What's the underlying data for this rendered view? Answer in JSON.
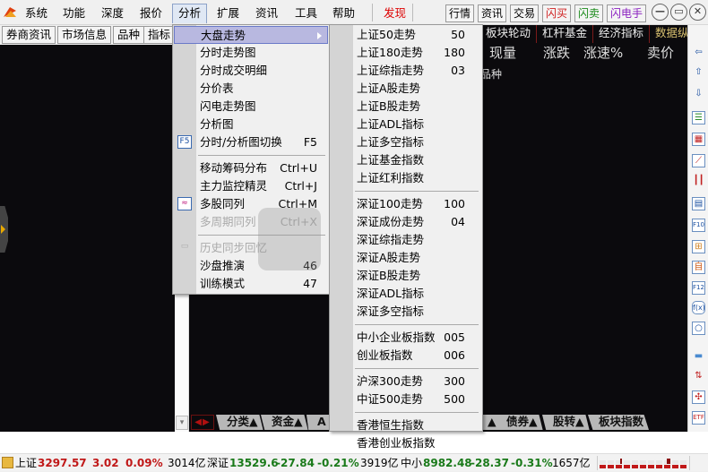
{
  "menubar": {
    "items": [
      "系统",
      "功能",
      "深度",
      "报价",
      "分析",
      "扩展",
      "资讯",
      "工具",
      "帮助",
      "发现"
    ],
    "active": "分析",
    "toolbar_buttons": [
      {
        "label": "行情",
        "color": "#000000"
      },
      {
        "label": "资讯",
        "color": "#000000"
      },
      {
        "label": "交易",
        "color": "#000000"
      },
      {
        "label": "闪买",
        "color": "#d02020"
      },
      {
        "label": "闪卖",
        "color": "#1a8a1a"
      },
      {
        "label": "闪电手",
        "color": "#8a20c0"
      }
    ],
    "window_controls": {
      "minimize": "—",
      "restore": "▭",
      "close": "✕"
    }
  },
  "subbar": {
    "buttons": [
      "券商资讯",
      "市场信息",
      "品种",
      "指标"
    ]
  },
  "header_tabs": [
    "板块轮动",
    "杠杆基金",
    "经济指标",
    "数据纵览"
  ],
  "column_headers": [
    "现量",
    "涨跌",
    "涨速%",
    "卖价"
  ],
  "row_label_fragment": "品种",
  "analysis_menu": {
    "items": [
      {
        "label": "大盘走势",
        "shortcut": "",
        "highlighted": true,
        "submenu": true
      },
      {
        "label": "分时走势图",
        "shortcut": ""
      },
      {
        "label": "分时成交明细",
        "shortcut": ""
      },
      {
        "label": "分价表",
        "shortcut": ""
      },
      {
        "label": "闪电走势图",
        "shortcut": ""
      },
      {
        "label": "分析图",
        "shortcut": ""
      },
      {
        "label": "分时/分析图切换",
        "shortcut": "F5",
        "icon": "F5"
      },
      {
        "separator": true
      },
      {
        "label": "移动筹码分布",
        "shortcut": "Ctrl+U"
      },
      {
        "label": "主力监控精灵",
        "shortcut": "Ctrl+J"
      },
      {
        "label": "多股同列",
        "shortcut": "Ctrl+M",
        "icon": "multi-chart"
      },
      {
        "label": "多周期同列",
        "shortcut": "Ctrl+X",
        "disabled": true
      },
      {
        "separator": true
      },
      {
        "label": "历史同步回忆",
        "shortcut": "",
        "disabled": true,
        "icon": "history"
      },
      {
        "label": "沙盘推演",
        "shortcut": "46"
      },
      {
        "label": "训练模式",
        "shortcut": "47"
      }
    ]
  },
  "market_submenu": {
    "groups": [
      [
        {
          "label": "上证50走势",
          "shortcut": "50"
        },
        {
          "label": "上证180走势",
          "shortcut": "180"
        },
        {
          "label": "上证综指走势",
          "shortcut": "03"
        },
        {
          "label": "上证A股走势",
          "shortcut": ""
        },
        {
          "label": "上证B股走势",
          "shortcut": ""
        },
        {
          "label": "上证ADL指标",
          "shortcut": ""
        },
        {
          "label": "上证多空指标",
          "shortcut": ""
        },
        {
          "label": "上证基金指数",
          "shortcut": ""
        },
        {
          "label": "上证红利指数",
          "shortcut": ""
        }
      ],
      [
        {
          "label": "深证100走势",
          "shortcut": "100"
        },
        {
          "label": "深证成份走势",
          "shortcut": "04"
        },
        {
          "label": "深证综指走势",
          "shortcut": ""
        },
        {
          "label": "深证A股走势",
          "shortcut": ""
        },
        {
          "label": "深证B股走势",
          "shortcut": ""
        },
        {
          "label": "深证ADL指标",
          "shortcut": ""
        },
        {
          "label": "深证多空指标",
          "shortcut": ""
        }
      ],
      [
        {
          "label": "中小企业板指数",
          "shortcut": "005"
        },
        {
          "label": "创业板指数",
          "shortcut": "006"
        }
      ],
      [
        {
          "label": "沪深300走势",
          "shortcut": "300"
        },
        {
          "label": "中证500走势",
          "shortcut": "500"
        }
      ],
      [
        {
          "label": "香港恒生指数",
          "shortcut": ""
        },
        {
          "label": "香港创业板指数",
          "shortcut": ""
        }
      ]
    ]
  },
  "bottom_tabs": [
    "分类▲",
    "资金▲",
    "A",
    "▲",
    "债券▲",
    "股转▲",
    "板块指数"
  ],
  "status": {
    "sh": {
      "name": "上证",
      "value": "3297.57",
      "change": "3.02",
      "pct": "0.09%",
      "volume": "3014亿"
    },
    "sz": {
      "name": "深证",
      "value": "13529.6",
      "change": "-27.84",
      "pct": "-0.21%",
      "volume": "3919亿"
    },
    "zx": {
      "name": "中小",
      "value": "8982.48",
      "change": "-28.37",
      "pct": "-0.31%",
      "volume": "1657亿"
    }
  },
  "right_toolbar_icons": [
    "arrow-left-icon",
    "arrow-up-icon",
    "arrow-down-icon",
    "checklist-icon",
    "grid-icon",
    "line-chart-icon",
    "candlestick-icon",
    "window-list-icon",
    "f10-icon",
    "tree-icon",
    "self-select-icon",
    "f12-icon",
    "function-icon",
    "circle-icon",
    "folder-icon",
    "up-down-arrows-icon",
    "expand-icon",
    "etf-icon",
    "import-icon"
  ],
  "colors": {
    "accent_red": "#c01818",
    "accent_green": "#1a7a1a",
    "menu_highlight": "#b8b8e0"
  }
}
